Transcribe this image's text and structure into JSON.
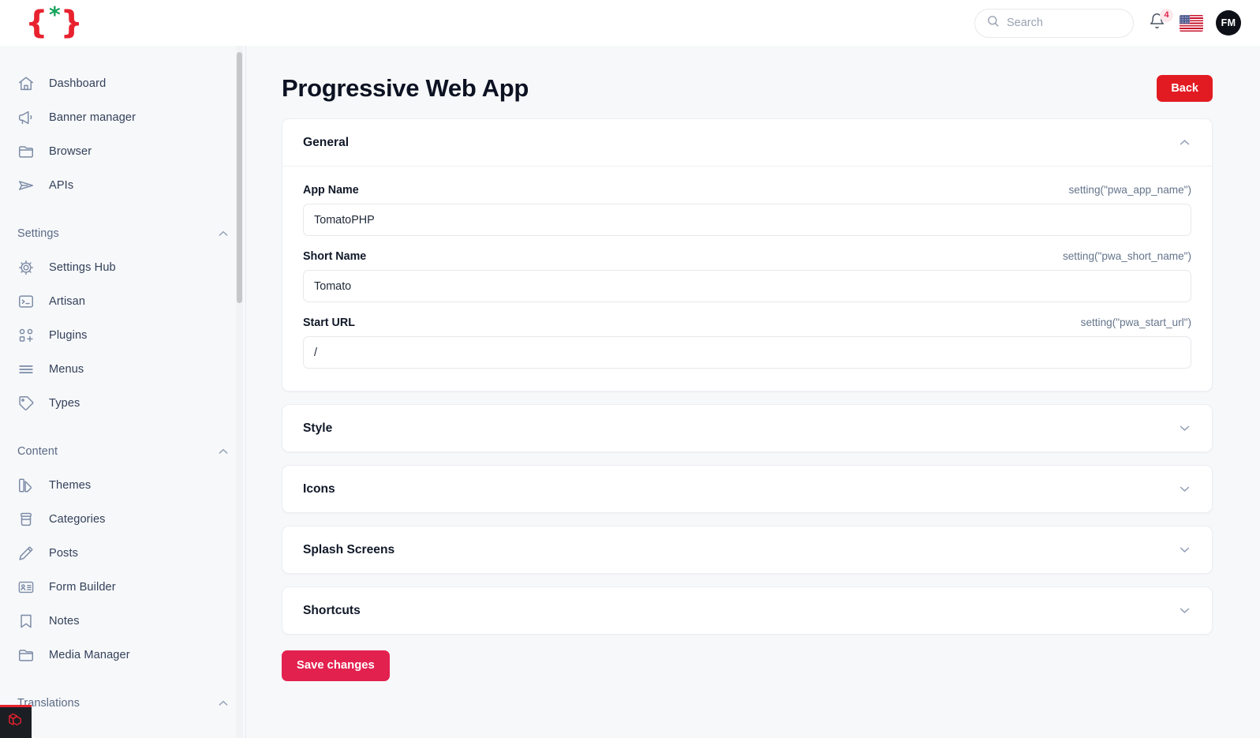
{
  "header": {
    "logo_name": "tomatophp-logo",
    "search": {
      "placeholder": "Search",
      "value": ""
    },
    "notifications_count": "4",
    "locale_flag": "us-flag",
    "avatar_initials": "FM"
  },
  "sidebar": {
    "top_items": [
      {
        "label": "Dashboard",
        "icon": "home-icon"
      },
      {
        "label": "Banner manager",
        "icon": "megaphone-icon"
      },
      {
        "label": "Browser",
        "icon": "folder-icon"
      },
      {
        "label": "APIs",
        "icon": "send-icon"
      }
    ],
    "groups": [
      {
        "title": "Settings",
        "chevron": "chevron-up-icon",
        "items": [
          {
            "label": "Settings Hub",
            "icon": "gear-icon"
          },
          {
            "label": "Artisan",
            "icon": "terminal-icon"
          },
          {
            "label": "Plugins",
            "icon": "plugins-icon"
          },
          {
            "label": "Menus",
            "icon": "menu-lines-icon"
          },
          {
            "label": "Types",
            "icon": "tag-icon"
          }
        ]
      },
      {
        "title": "Content",
        "chevron": "chevron-up-icon",
        "items": [
          {
            "label": "Themes",
            "icon": "themes-icon"
          },
          {
            "label": "Categories",
            "icon": "archive-icon"
          },
          {
            "label": "Posts",
            "icon": "pencil-icon"
          },
          {
            "label": "Form Builder",
            "icon": "id-card-icon"
          },
          {
            "label": "Notes",
            "icon": "bookmark-icon"
          },
          {
            "label": "Media Manager",
            "icon": "folder-icon"
          }
        ]
      },
      {
        "title": "Translations",
        "chevron": "chevron-up-icon",
        "items": []
      }
    ],
    "debugbar_icon": "laravel-logo"
  },
  "page": {
    "title": "Progressive Web App",
    "back_label": "Back",
    "save_label": "Save changes"
  },
  "sections": {
    "general": {
      "title": "General",
      "expanded": true,
      "chevron": "chevron-up-icon",
      "fields": [
        {
          "label": "App Name",
          "hint": "setting(\"pwa_app_name\")",
          "value": "TomatoPHP",
          "placeholder": "App Name"
        },
        {
          "label": "Short Name",
          "hint": "setting(\"pwa_short_name\")",
          "value": "Tomato",
          "placeholder": "Short Name"
        },
        {
          "label": "Start URL",
          "hint": "setting(\"pwa_start_url\")",
          "value": "/",
          "placeholder": "Start URL"
        }
      ]
    },
    "collapsed": [
      {
        "title": "Style",
        "chevron": "chevron-down-icon"
      },
      {
        "title": "Icons",
        "chevron": "chevron-down-icon"
      },
      {
        "title": "Splash Screens",
        "chevron": "chevron-down-icon"
      },
      {
        "title": "Shortcuts",
        "chevron": "chevron-down-icon"
      }
    ]
  },
  "colors": {
    "brand_red": "#e21b22",
    "brand_green": "#15a35b",
    "save_pink": "#e3214f",
    "page_bg": "#f7f8fa",
    "badge_text": "#e0264c"
  }
}
